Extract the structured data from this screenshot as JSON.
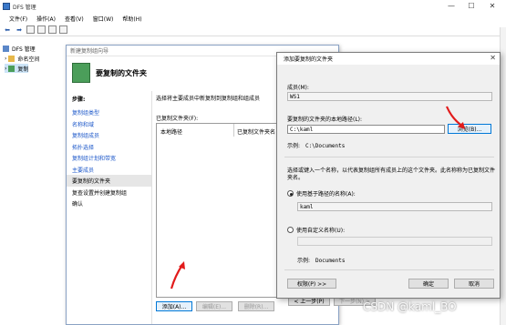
{
  "window": {
    "title": "DFS 管理",
    "minimize": "—",
    "maximize": "☐",
    "close": "✕"
  },
  "menu": [
    "文件(F)",
    "操作(A)",
    "查看(V)",
    "窗口(W)",
    "帮助(H)"
  ],
  "tree": {
    "root": "DFS 管理",
    "namespace": "命名空间",
    "replication": "复制"
  },
  "wizard": {
    "title": "新建复制组向导",
    "header": "要复制的文件夹",
    "steps_title": "步骤:",
    "steps": [
      "复制组类型",
      "名称和域",
      "复制组成员",
      "拓扑选择",
      "复制组计划和带宽",
      "主要成员",
      "要复制的文件夹",
      "复查设置并创建复制组",
      "确认"
    ],
    "current_step": 6,
    "description": "选择将主要成员中新复制到复制组和组成员",
    "folders_label": "已复制文件夹(F):",
    "col_local_path": "本地路径",
    "col_replicated": "已复制文件夹名",
    "add_btn": "添加(A)...",
    "edit_btn": "编辑(E)...",
    "delete_btn": "删除(R)...",
    "back_btn": "< 上一步(P)",
    "next_btn": "下一步(N) >"
  },
  "dialog": {
    "title": "添加要复制的文件夹",
    "close": "✕",
    "member_label": "成员(M):",
    "member_value": "WS1",
    "path_label": "要复制的文件夹的本地路径(L):",
    "path_value": "C:\\kaml",
    "browse_btn": "浏览(B)...",
    "example_label": "示例:",
    "example_value": "C:\\Documents",
    "select_text": "选择或键入一个名称，以代表复制组所有成员上的这个文件夹。此名称称为已复制文件夹名。",
    "radio_based": "使用基于路径的名称(A):",
    "based_value": "kaml",
    "radio_custom": "使用自定义名称(U):",
    "example2_value": "Documents",
    "perm_btn": "权限(P) >>",
    "ok_btn": "确定",
    "cancel_btn": "取消"
  },
  "watermark": "CSDN @kaml_BO",
  "colors": {
    "accent": "#0078d7",
    "arrow": "#e21b1b",
    "link": "#1a56c9"
  }
}
